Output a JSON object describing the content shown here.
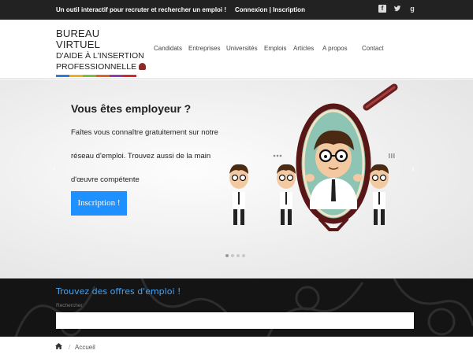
{
  "topbar": {
    "tagline": "Un outil interactif pour recruter et rechercher un emploi !",
    "login": "Connexion",
    "separator": "|",
    "signup": "Inscription",
    "social_icons": [
      "facebook-icon",
      "twitter-icon",
      "google-plus-icon"
    ]
  },
  "logo": {
    "line1": "BUREAU VIRTUEL",
    "line2": "D'AIDE  À  L'INSERTION",
    "line3": "PROFESSIONNELLE",
    "stripe_colors": [
      "#2d7fd3",
      "#f2b01e",
      "#7bbf3a",
      "#e0632a",
      "#8e3cb0",
      "#d8262f"
    ]
  },
  "nav": {
    "items": [
      "Candidats",
      "Entreprises",
      "Universités",
      "Emplois",
      "Articles",
      "A propos",
      "Contact"
    ]
  },
  "hero": {
    "title": "Vous êtes employeur ?",
    "text": "Faîtes vous connaître gratuitement sur notre réseau d'emploi. Trouvez aussi de la main d'œuvre compétente",
    "button": "Inscription !",
    "prev_arrow": "‹",
    "next_arrow": "›",
    "slide_count": 4,
    "active_slide": 1
  },
  "search": {
    "title": "Trouvez des offres d'emploi !",
    "label": "Rechercher",
    "placeholder": ""
  },
  "breadcrumb": {
    "separator": "/",
    "current": "Accueil"
  },
  "colors": {
    "accent": "#1e90ff",
    "search_title": "#4aa3f0",
    "topbar_bg": "#222222"
  }
}
